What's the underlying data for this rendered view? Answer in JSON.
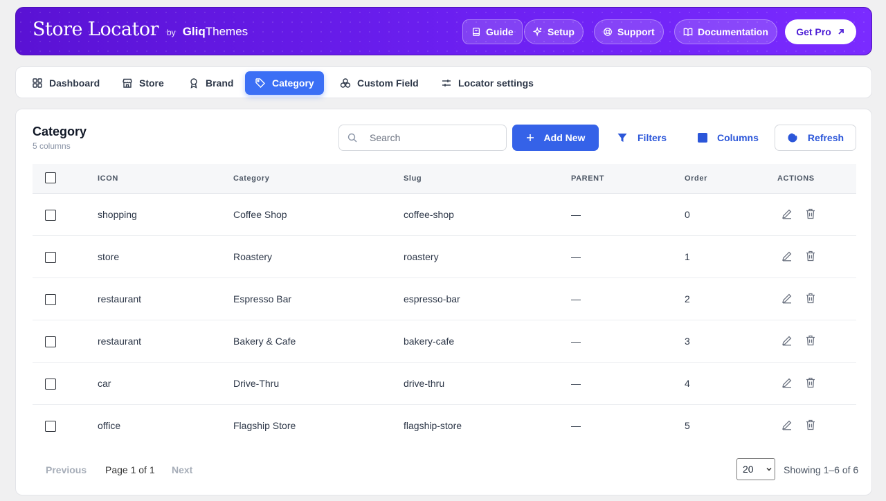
{
  "header": {
    "logo_main": "Store Locator",
    "logo_by": "by",
    "logo_brand_bold": "Gliq",
    "logo_brand_rest": "Themes",
    "buttons": {
      "guide": "Guide",
      "setup": "Setup",
      "support": "Support",
      "documentation": "Documentation",
      "get_pro": "Get Pro"
    }
  },
  "tabs": [
    {
      "label": "Dashboard",
      "icon": "grid-icon"
    },
    {
      "label": "Store",
      "icon": "store-icon"
    },
    {
      "label": "Brand",
      "icon": "award-icon"
    },
    {
      "label": "Category",
      "icon": "tag-icon",
      "active": true
    },
    {
      "label": "Custom Field",
      "icon": "circles-icon"
    },
    {
      "label": "Locator settings",
      "icon": "sliders-icon"
    }
  ],
  "card": {
    "title": "Category",
    "subtitle": "5 columns",
    "search_placeholder": "Search",
    "add_new": "Add New",
    "filters": "Filters",
    "columns": "Columns",
    "refresh": "Refresh"
  },
  "table": {
    "headers": {
      "icon": "ICON",
      "category": "Category",
      "slug": "Slug",
      "parent": "PARENT",
      "order": "Order",
      "actions": "ACTIONS"
    },
    "rows": [
      {
        "icon": "shopping",
        "category": "Coffee Shop",
        "slug": "coffee-shop",
        "parent": "—",
        "order": "0"
      },
      {
        "icon": "store",
        "category": "Roastery",
        "slug": "roastery",
        "parent": "—",
        "order": "1"
      },
      {
        "icon": "restaurant",
        "category": "Espresso Bar",
        "slug": "espresso-bar",
        "parent": "—",
        "order": "2"
      },
      {
        "icon": "restaurant",
        "category": "Bakery & Cafe",
        "slug": "bakery-cafe",
        "parent": "—",
        "order": "3"
      },
      {
        "icon": "car",
        "category": "Drive-Thru",
        "slug": "drive-thru",
        "parent": "—",
        "order": "4"
      },
      {
        "icon": "office",
        "category": "Flagship Store",
        "slug": "flagship-store",
        "parent": "—",
        "order": "5"
      }
    ]
  },
  "pagination": {
    "previous": "Previous",
    "page_info": "Page 1 of 1",
    "next": "Next",
    "per_page": "20",
    "showing": "Showing 1–6 of 6"
  },
  "colors": {
    "accent": "#3562e8",
    "header_start": "#5a12d4",
    "header_end": "#7a2bff"
  }
}
